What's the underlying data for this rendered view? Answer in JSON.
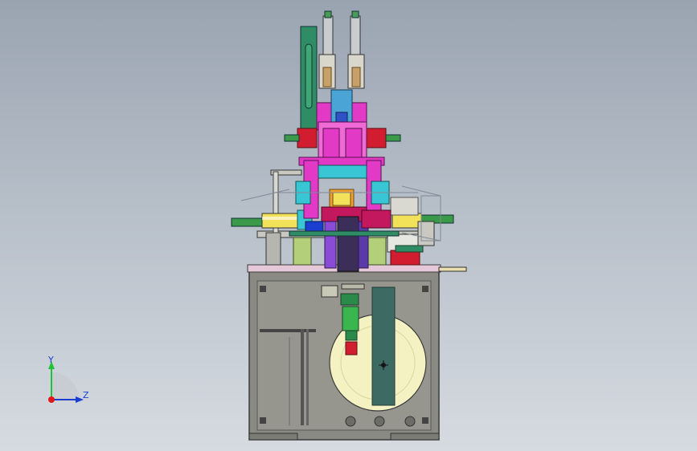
{
  "axes": {
    "y_label": "Y",
    "z_label": "Z",
    "y_color": "#1fc23a",
    "z_color": "#1a3fd0",
    "origin_color": "#e01818"
  },
  "colors": {
    "background_top": "#9aa4b1",
    "background_bottom": "#d6dbe1",
    "frame": "#8a8a84",
    "frame_edge": "#3a3a3a",
    "plate": "#e6c9d8",
    "magenta": "#e23ac7",
    "pink": "#f06ad6",
    "red": "#d11d2f",
    "green": "#2f8c64",
    "cyan": "#38c6d4",
    "yellow": "#f2e25a",
    "olive": "#b4cf7a",
    "purple": "#8a4bd6",
    "disc": "#f4f2c2",
    "slider": "#3d6b63"
  }
}
